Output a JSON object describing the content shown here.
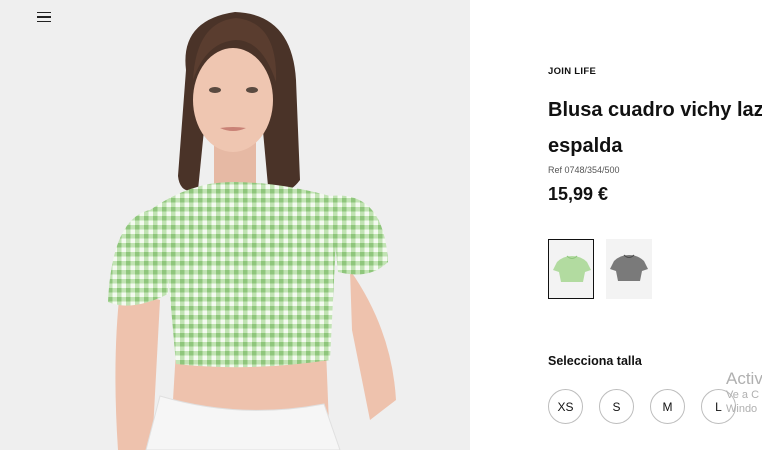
{
  "header": {
    "menu_icon": "hamburger-menu-icon"
  },
  "product": {
    "brand": "JOIN LIFE",
    "title": "Blusa cuadro vichy lazo espalda",
    "ref": "Ref 0748/354/500",
    "price": "15,99 €"
  },
  "colors": [
    {
      "name": "green-gingham",
      "hex": "#a8d49a",
      "selected": true
    },
    {
      "name": "black-gingham",
      "hex": "#6e6e6e",
      "selected": false
    }
  ],
  "size_selector": {
    "label": "Selecciona talla",
    "sizes": [
      "XS",
      "S",
      "M",
      "L"
    ]
  },
  "overlay": {
    "line1": "Activ",
    "line2": "Ve a C",
    "line3": "Windo"
  }
}
